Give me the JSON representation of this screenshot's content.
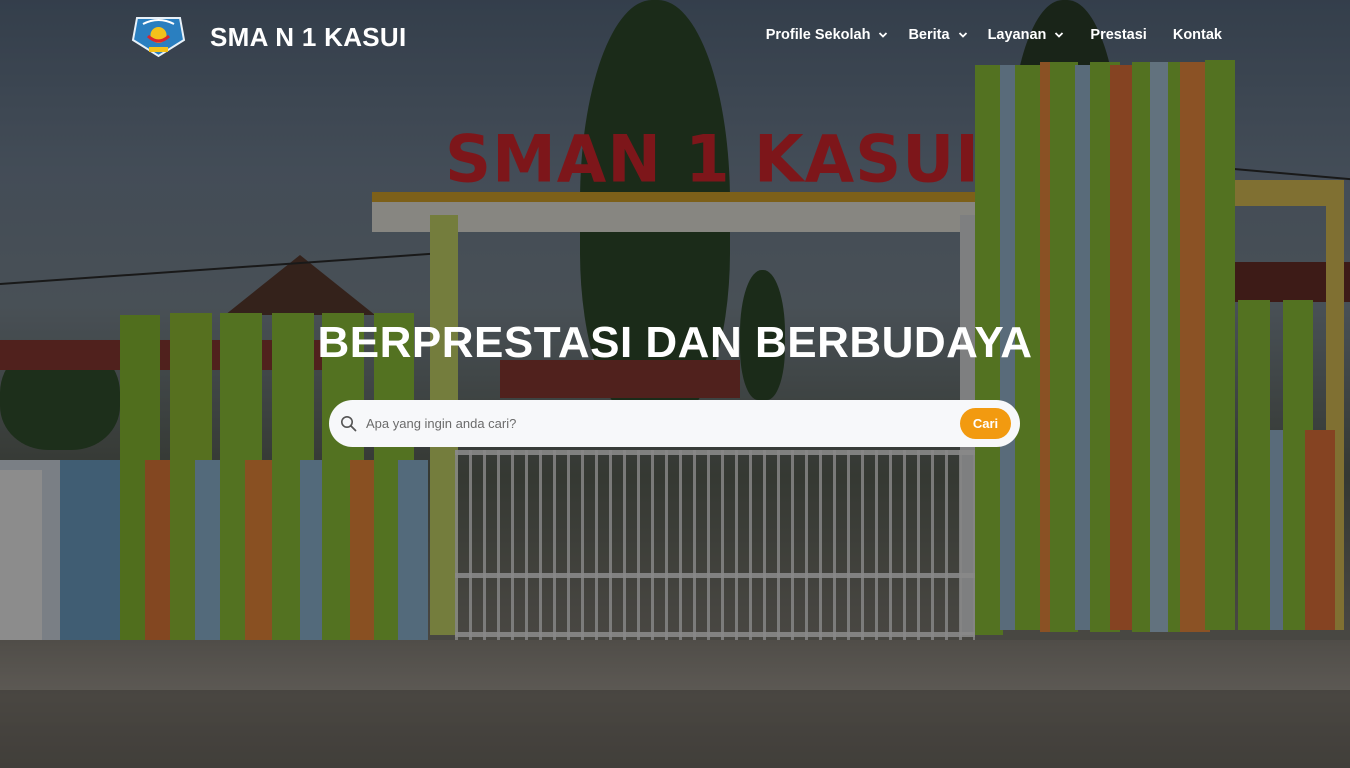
{
  "header": {
    "site_title": "SMA N 1 KASUI",
    "logo_icon": "school-emblem-icon",
    "nav": [
      {
        "label": "Profile Sekolah",
        "has_dropdown": true
      },
      {
        "label": "Berita",
        "has_dropdown": true
      },
      {
        "label": "Layanan",
        "has_dropdown": true
      },
      {
        "label": "Prestasi",
        "has_dropdown": false
      },
      {
        "label": "Kontak",
        "has_dropdown": false
      }
    ]
  },
  "hero": {
    "headline": "BERPRESTASI DAN BERBUDAYA",
    "photo_sign_text": "SMAN 1 KASUI"
  },
  "search": {
    "placeholder": "Apa yang ingin anda cari?",
    "value": "",
    "button_label": "Cari",
    "icon": "search-icon"
  },
  "colors": {
    "accent": "#f29a10",
    "text_light": "#ffffff",
    "search_bg": "#f7f8fa"
  }
}
